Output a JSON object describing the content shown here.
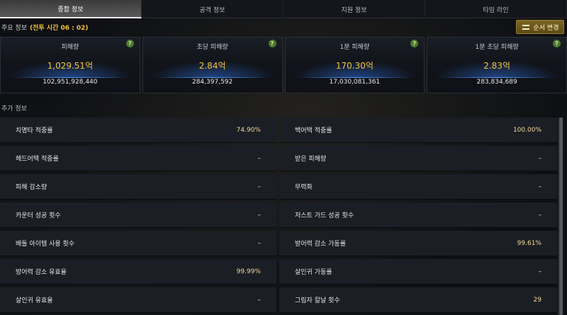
{
  "tabs": [
    "종합 정보",
    "공격 정보",
    "지원 정보",
    "타임 라인"
  ],
  "active_tab": 0,
  "main_info": {
    "label": "주요 정보",
    "time": "(전투 시간 06 : 02)"
  },
  "order_button": {
    "label": "순서 변경"
  },
  "summary_cards": [
    {
      "label": "피해량",
      "value": "1,029.51억",
      "raw": "102,951,928,440"
    },
    {
      "label": "초당 피해량",
      "value": "2.84억",
      "raw": "284,397,592"
    },
    {
      "label": "1분 피해량",
      "value": "170.30억",
      "raw": "17,030,081,361"
    },
    {
      "label": "1분 초당 피해량",
      "value": "2.83억",
      "raw": "283,834,689"
    }
  ],
  "help_glyph": "?",
  "extra_info": {
    "label": "추가 정보"
  },
  "stats": [
    {
      "label": "치명타 적중률",
      "value": "74.90%"
    },
    {
      "label": "백어택 적중률",
      "value": "100.00%"
    },
    {
      "label": "헤드어택 적중률",
      "value": "–"
    },
    {
      "label": "받은 피해량",
      "value": "–"
    },
    {
      "label": "피해 감소량",
      "value": "–"
    },
    {
      "label": "무력화",
      "value": "–"
    },
    {
      "label": "카운터 성공 횟수",
      "value": "–"
    },
    {
      "label": "저스트 가드 성공 횟수",
      "value": "–"
    },
    {
      "label": "배틀 아이템 사용 횟수",
      "value": "–"
    },
    {
      "label": "방어력 감소 가동률",
      "value": "99.61%"
    },
    {
      "label": "방어력 감소 유효율",
      "value": "99.99%"
    },
    {
      "label": "살인귀 가동률",
      "value": "–"
    },
    {
      "label": "살인귀 유효율",
      "value": "–"
    },
    {
      "label": "그림자 칼날 횟수",
      "value": "29"
    }
  ],
  "colors": {
    "accent_gold": "#f2c23b",
    "button_gold": "#7b6524",
    "help_green": "#4c7a2e"
  }
}
